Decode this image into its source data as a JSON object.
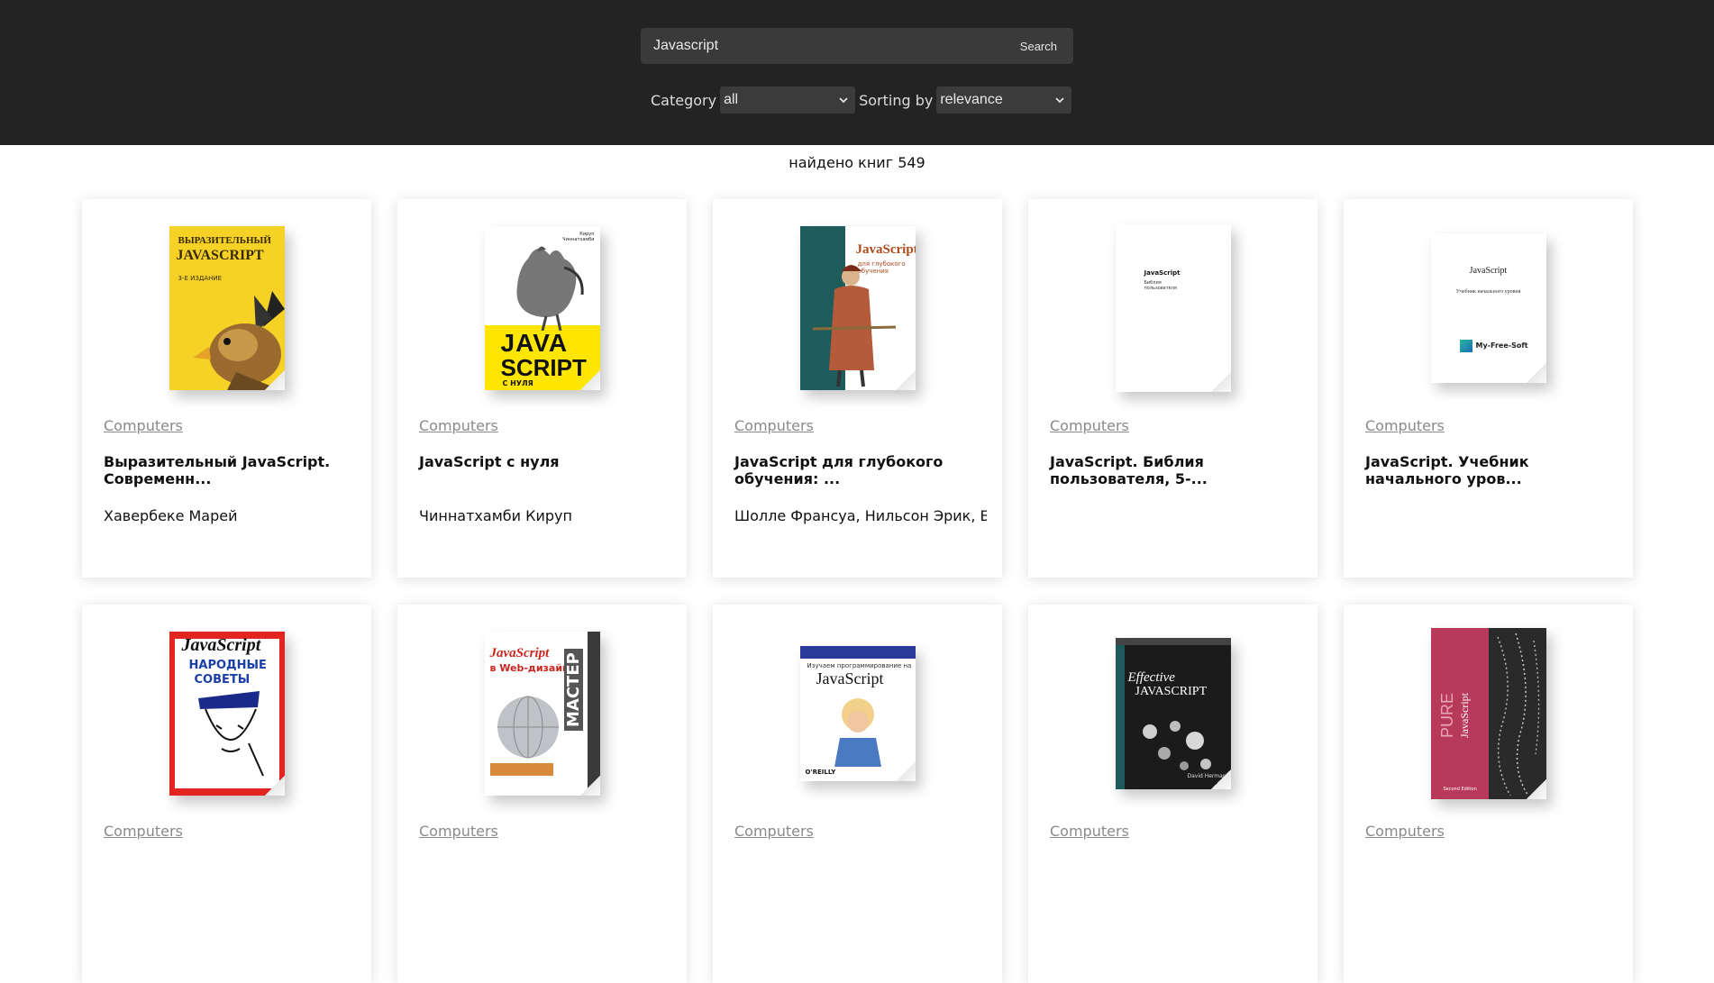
{
  "search": {
    "value": "Javascript",
    "button_label": "Search"
  },
  "filters": {
    "category_label": "Category",
    "category_value": "all",
    "sort_label": "Sorting by",
    "sort_value": "relevance"
  },
  "results_text": "найдено книг 549",
  "books": [
    {
      "category": "Computers",
      "title": "Выразительный JavaScript. Современн...",
      "author": "Хавербеке Марей",
      "cover": {
        "bg": "#f6d226",
        "lines": [
          "ВЫРАЗИТЕЛЬНЫЙ",
          "JAVASCRIPT",
          "3-Е ИЗДАНИЕ"
        ]
      }
    },
    {
      "category": "Computers",
      "title": "JavaScript с нуля",
      "author": "Чиннатхамби Кируп",
      "cover": {
        "bg": "#ffe600",
        "lines": [
          "Кируп Чиннатхамби",
          "JAVA",
          "SCRIPT",
          "С НУЛЯ"
        ]
      }
    },
    {
      "category": "Computers",
      "title": "JavaScript для глубокого обучения: ...",
      "author": "Шолле Франсуа, Нильсон Эрик, Б...",
      "cover": {
        "bg": "#1f5c5c",
        "lines": [
          "JavaScript",
          "для глубокого обучения"
        ]
      }
    },
    {
      "category": "Computers",
      "title": "JavaScript. Библия пользователя, 5-...",
      "author": "",
      "cover": {
        "bg": "#ffffff",
        "lines": [
          "JavaScript",
          "Библия пользователя"
        ]
      }
    },
    {
      "category": "Computers",
      "title": "JavaScript. Учебник начального уров...",
      "author": "",
      "cover": {
        "bg": "#ffffff",
        "lines": [
          "JavaScript",
          "Учебник начального уровня",
          "My-Free-Soft"
        ]
      }
    },
    {
      "category": "Computers",
      "title": "",
      "author": "",
      "cover": {
        "bg": "#e32421",
        "lines": [
          "JavaScript",
          "НАРОДНЫЕ",
          "СОВЕТЫ"
        ]
      }
    },
    {
      "category": "Computers",
      "title": "",
      "author": "",
      "cover": {
        "bg": "#ffffff",
        "lines": [
          "JavaScript",
          "в Web-дизайне",
          "МАСТЕР"
        ]
      }
    },
    {
      "category": "Computers",
      "title": "",
      "author": "",
      "cover": {
        "bg": "#ffffff",
        "lines": [
          "Изучаем программирование на",
          "JavaScript",
          "O'REILLY"
        ]
      }
    },
    {
      "category": "Computers",
      "title": "",
      "author": "",
      "cover": {
        "bg": "#1b1b1b",
        "lines": [
          "Effective",
          "JAVASCRIPT",
          "David Herman"
        ]
      }
    },
    {
      "category": "Computers",
      "title": "",
      "author": "",
      "cover": {
        "bg": "#b83a5a",
        "lines": [
          "PURE",
          "JavaScript",
          "Second Edition"
        ]
      }
    }
  ]
}
